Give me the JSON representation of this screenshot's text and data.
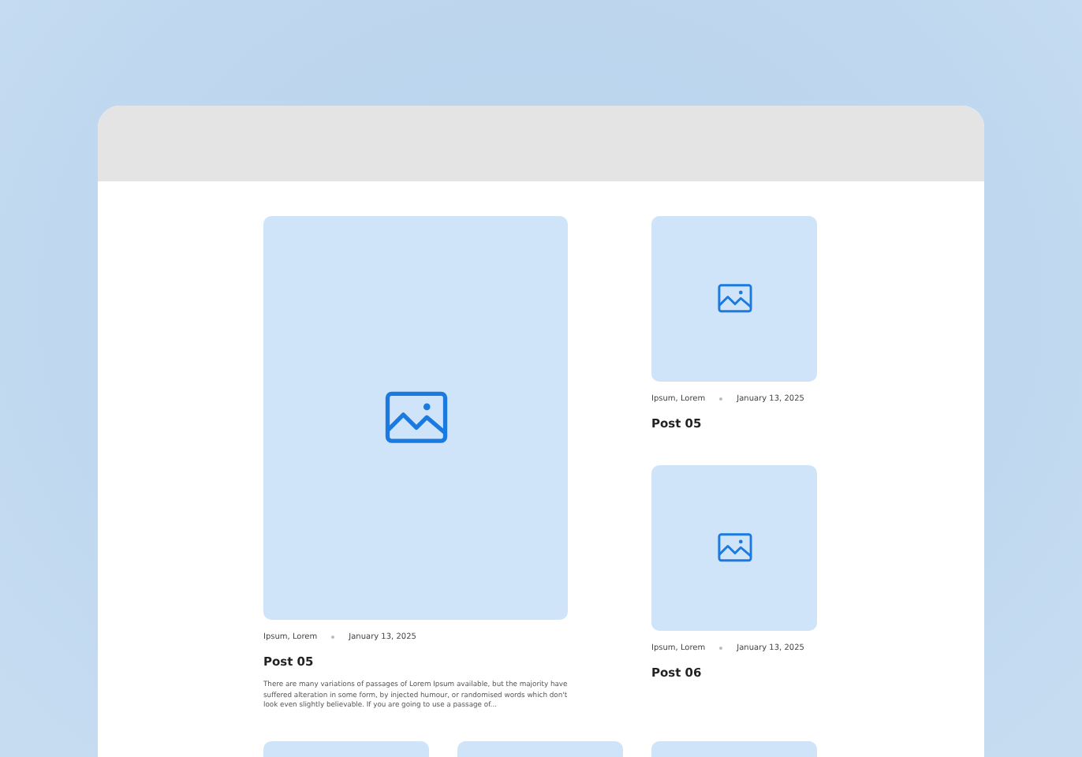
{
  "featured": {
    "kind": "picture",
    "meta": {
      "categories": "Ipsum, Lorem",
      "date": "January 13, 2025"
    },
    "title": "Post 05",
    "excerpt": "There are many variations of passages of Lorem Ipsum available, but the majority have suffered alteration in some form, by injected humour, or randomised words which don't look even slightly believable. If you are going to use a passage of..."
  },
  "side_posts": [
    {
      "meta": {
        "categories": "Ipsum, Lorem",
        "date": "January 13, 2025"
      },
      "title": "Post 05"
    },
    {
      "meta": {
        "categories": "Ipsum, Lorem",
        "date": "January 13, 2025"
      },
      "title": "Post 06"
    }
  ],
  "bottom_cards": [
    {
      "kind": "placeholder"
    },
    {
      "kind": "placeholder"
    },
    {
      "kind": "placeholder"
    }
  ]
}
